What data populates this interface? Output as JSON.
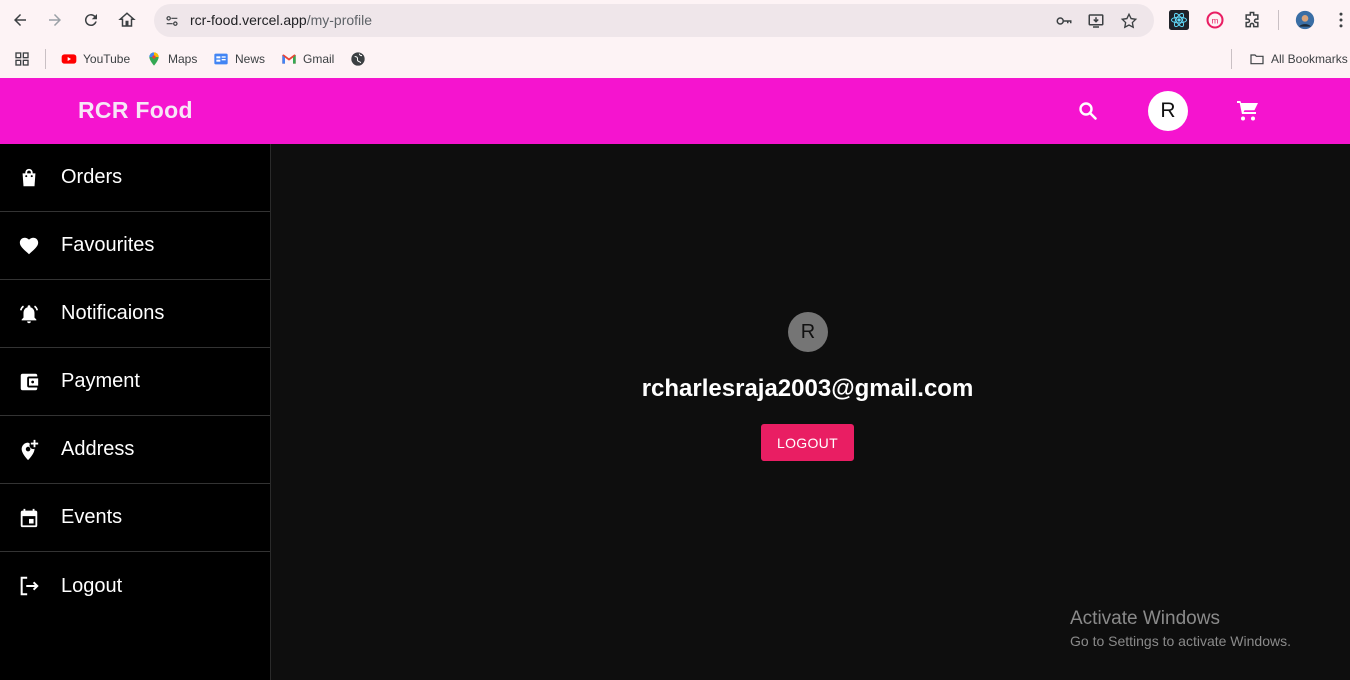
{
  "browser": {
    "url_host": "rcr-food.vercel.app",
    "url_path": "/my-profile",
    "bookmarks": [
      {
        "label": "YouTube",
        "icon": "youtube-icon"
      },
      {
        "label": "Maps",
        "icon": "maps-icon"
      },
      {
        "label": "News",
        "icon": "news-icon"
      },
      {
        "label": "Gmail",
        "icon": "gmail-icon"
      }
    ],
    "all_bookmarks_label": "All Bookmarks"
  },
  "header": {
    "brand": "RCR Food",
    "avatar_letter": "R",
    "color": "#f514cf"
  },
  "sidebar": {
    "items": [
      {
        "label": "Orders",
        "icon": "shopping-bag-icon"
      },
      {
        "label": "Favourites",
        "icon": "heart-icon"
      },
      {
        "label": "Notificaions",
        "icon": "notification-bell-icon"
      },
      {
        "label": "Payment",
        "icon": "wallet-icon"
      },
      {
        "label": "Address",
        "icon": "add-location-icon"
      },
      {
        "label": "Events",
        "icon": "calendar-event-icon"
      },
      {
        "label": "Logout",
        "icon": "logout-icon"
      }
    ]
  },
  "profile": {
    "avatar_letter": "R",
    "email": "rcharlesraja2003@gmail.com",
    "logout_label": "LOGOUT",
    "logout_color": "#e91e63"
  },
  "watermark": {
    "title": "Activate Windows",
    "subtitle": "Go to Settings to activate Windows."
  }
}
